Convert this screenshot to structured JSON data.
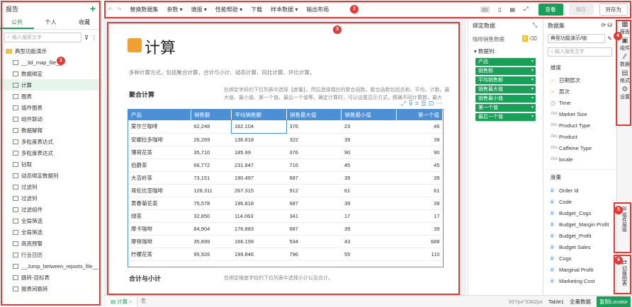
{
  "left_panel": {
    "title": "报告",
    "tabs": [
      "公共",
      "个人",
      "收藏"
    ],
    "search_placeholder": "输入搜索文字",
    "folder": "典型功能演示",
    "items": [
      "__3d_map_file__",
      "数据绑定",
      "计算",
      "图表",
      "插件图表",
      "组件联动",
      "数据解释",
      "多粒度表达式",
      "多粒度表达式",
      "钻取",
      "动态绑定数据列",
      "过滤列",
      "过滤列",
      "过滤组件",
      "全局筛选",
      "全局筛选",
      "高亮预警",
      "行业日历",
      "__Jump_between_reports_file__",
      "跳转-目标表",
      "报表间跳转"
    ]
  },
  "toolbar": {
    "items": [
      "替换数据集",
      "参数",
      "填报",
      "性能帮助",
      "下载",
      "样本数据",
      "输出布局"
    ],
    "view": "查看",
    "save": "保存",
    "save_as": "另存为"
  },
  "page": {
    "title": "计算",
    "desc": "多种计算方式，包括聚合计算、合计与小计、动态计算、同比计算、环比计算。",
    "section1": "聚合计算",
    "section1_desc": "在绑定字段的下拉列表中选择【度量】，然后选择相应的聚合函数。聚合函数包括总和、平均、计数、最大值、最小值、第一个值、最后一个值等。确定计算时，可以设置显示方式，精确不同计算数，最大值、最小值等。",
    "section2": "合计与小计",
    "section2_desc": "在绑定维度字段的下拉列表中选择小计以及合计。"
  },
  "table": {
    "headers": [
      "产品",
      "销售额",
      "平均销售额",
      "销售最大值",
      "销售最小值",
      "第一个值"
    ],
    "rows": [
      [
        "爱尔兰咖啡",
        "62,248",
        "162.104",
        "376",
        "23",
        "46"
      ],
      [
        "安娜拉多咖啡",
        "26,269",
        "136.818",
        "322",
        "39",
        "39"
      ],
      [
        "薄荷花茶",
        "35,710",
        "185.99",
        "376",
        "90",
        "90"
      ],
      [
        "伯爵茶",
        "66,772",
        "231.847",
        "716",
        "45",
        "45"
      ],
      [
        "大吉岭茶",
        "73,151",
        "190.497",
        "687",
        "39",
        "39"
      ],
      [
        "哥伦比亚咖啡",
        "128,311",
        "267.315",
        "912",
        "61",
        "61"
      ],
      [
        "黄春菊花茶",
        "75,578",
        "196.818",
        "687",
        "39",
        "39"
      ],
      [
        "绿茶",
        "32,850",
        "114.063",
        "341",
        "17",
        "17"
      ],
      [
        "摩卡咖啡",
        "84,904",
        "176.883",
        "687",
        "39",
        "39"
      ],
      [
        "摩铁咖啡",
        "35,899",
        "166.199",
        "534",
        "43",
        "688"
      ],
      [
        "柠檬花茶",
        "95,926",
        "199.846",
        "796",
        "55",
        "110"
      ]
    ]
  },
  "bind_panel": {
    "title": "绑定数据",
    "dataset": "咖啡销售数据",
    "label": "数据列:",
    "fields": [
      "产品",
      "销售额",
      "平均销售额",
      "销售最大值",
      "销售最小值",
      "第一个值",
      "最后一个值"
    ]
  },
  "ds_panel": {
    "title": "数据集",
    "selected": "典型功能演示/咖",
    "search_placeholder": "输入搜索文字",
    "dims_label": "维度",
    "dims": [
      [
        "folder",
        "日期层次"
      ],
      [
        "folder",
        "层次"
      ],
      [
        "clock",
        "Time"
      ],
      [
        "Abc",
        "Market Size"
      ],
      [
        "Abc",
        "Product Type"
      ],
      [
        "Abc",
        "Product"
      ],
      [
        "Abc",
        "Caffeine Type"
      ],
      [
        "Abc",
        "locale"
      ]
    ],
    "measures_label": "度量",
    "measures": [
      "Order Id",
      "Code",
      "Budget_Cogs",
      "Budget_Margin Profit",
      "Budget_Profit",
      "Budget Sales",
      "Cogs",
      "Marginal Profit",
      "Marketing Cost"
    ]
  },
  "side": [
    "报告",
    "组件",
    "数据",
    "格式",
    "设置",
    "组件层级",
    "切换图表"
  ],
  "bottom": {
    "tab": "计算",
    "size": "937px*3362px",
    "table": "Table1",
    "all": "全量数据",
    "locator": "复制Locator"
  },
  "badges": [
    "1",
    "2",
    "3",
    "4",
    "5",
    "6"
  ]
}
